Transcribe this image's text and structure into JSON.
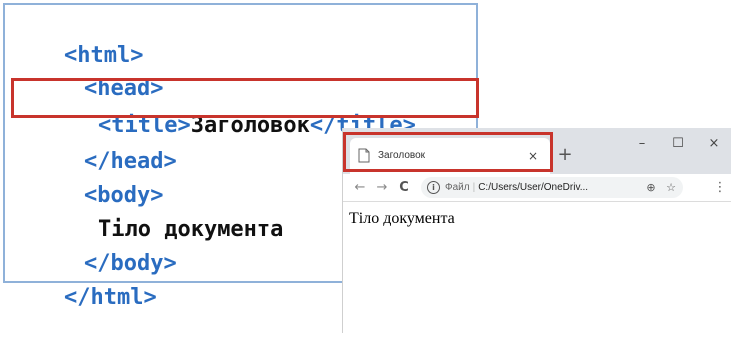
{
  "code": {
    "html_open": "<html>",
    "head_open": "<head>",
    "title_open": "<title>",
    "title_text": "Заголовок",
    "title_close": "</title>",
    "head_close": "</head>",
    "body_open": "<body>",
    "body_text": "Тіло документа",
    "body_close": "</body>",
    "html_close": "</html>"
  },
  "browser": {
    "tab_title": "Заголовок",
    "tab_close": "×",
    "new_tab": "+",
    "minimize": "–",
    "maximize": "☐",
    "close": "×",
    "back": "←",
    "forward": "→",
    "reload": "C",
    "info": "i",
    "scheme_label": "Файл",
    "url": "C:/Users/User/OneDriv...",
    "zoom_icon": "⊕",
    "star_icon": "☆",
    "menu_icon": "⋮",
    "page_text": "Тіло документа"
  },
  "colors": {
    "tag": "#2a6cc0",
    "highlight": "#c8342c",
    "panel_border": "#8fb1d9"
  }
}
